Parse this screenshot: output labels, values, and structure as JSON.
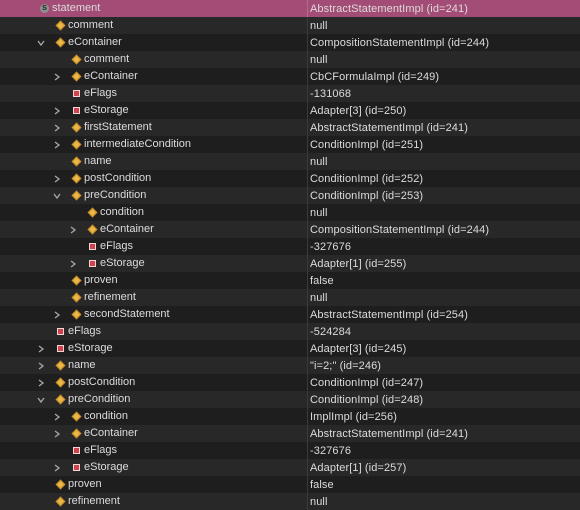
{
  "rows": [
    {
      "name": "statement",
      "value": "AbstractStatementImpl  (id=241)",
      "depth": 0,
      "chev": "none",
      "icon": "static",
      "selected": true
    },
    {
      "name": "comment",
      "value": "null",
      "depth": 1,
      "chev": "none",
      "icon": "diamond"
    },
    {
      "name": "eContainer",
      "value": "CompositionStatementImpl  (id=244)",
      "depth": 1,
      "chev": "down",
      "icon": "diamond"
    },
    {
      "name": "comment",
      "value": "null",
      "depth": 2,
      "chev": "none",
      "icon": "diamond"
    },
    {
      "name": "eContainer",
      "value": "CbCFormulaImpl  (id=249)",
      "depth": 2,
      "chev": "right",
      "icon": "diamond"
    },
    {
      "name": "eFlags",
      "value": "-131068",
      "depth": 2,
      "chev": "none",
      "icon": "square"
    },
    {
      "name": "eStorage",
      "value": "Adapter[3]  (id=250)",
      "depth": 2,
      "chev": "right",
      "icon": "square"
    },
    {
      "name": "firstStatement",
      "value": "AbstractStatementImpl  (id=241)",
      "depth": 2,
      "chev": "right",
      "icon": "diamond"
    },
    {
      "name": "intermediateCondition",
      "value": "ConditionImpl  (id=251)",
      "depth": 2,
      "chev": "right",
      "icon": "diamond"
    },
    {
      "name": "name",
      "value": "null",
      "depth": 2,
      "chev": "none",
      "icon": "diamond"
    },
    {
      "name": "postCondition",
      "value": "ConditionImpl  (id=252)",
      "depth": 2,
      "chev": "right",
      "icon": "diamond"
    },
    {
      "name": "preCondition",
      "value": "ConditionImpl  (id=253)",
      "depth": 2,
      "chev": "down",
      "icon": "diamond"
    },
    {
      "name": "condition",
      "value": "null",
      "depth": 3,
      "chev": "none",
      "icon": "diamond"
    },
    {
      "name": "eContainer",
      "value": "CompositionStatementImpl  (id=244)",
      "depth": 3,
      "chev": "right",
      "icon": "diamond"
    },
    {
      "name": "eFlags",
      "value": "-327676",
      "depth": 3,
      "chev": "none",
      "icon": "square"
    },
    {
      "name": "eStorage",
      "value": "Adapter[1]  (id=255)",
      "depth": 3,
      "chev": "right",
      "icon": "square"
    },
    {
      "name": "proven",
      "value": "false",
      "depth": 2,
      "chev": "none",
      "icon": "diamond"
    },
    {
      "name": "refinement",
      "value": "null",
      "depth": 2,
      "chev": "none",
      "icon": "diamond"
    },
    {
      "name": "secondStatement",
      "value": "AbstractStatementImpl  (id=254)",
      "depth": 2,
      "chev": "right",
      "icon": "diamond"
    },
    {
      "name": "eFlags",
      "value": "-524284",
      "depth": 1,
      "chev": "none",
      "icon": "square"
    },
    {
      "name": "eStorage",
      "value": "Adapter[3]  (id=245)",
      "depth": 1,
      "chev": "right",
      "icon": "square"
    },
    {
      "name": "name",
      "value": "\"i=2;\" (id=246)",
      "depth": 1,
      "chev": "right",
      "icon": "diamond"
    },
    {
      "name": "postCondition",
      "value": "ConditionImpl  (id=247)",
      "depth": 1,
      "chev": "right",
      "icon": "diamond"
    },
    {
      "name": "preCondition",
      "value": "ConditionImpl  (id=248)",
      "depth": 1,
      "chev": "down",
      "icon": "diamond"
    },
    {
      "name": "condition",
      "value": "ImplImpl  (id=256)",
      "depth": 2,
      "chev": "right",
      "icon": "diamond"
    },
    {
      "name": "eContainer",
      "value": "AbstractStatementImpl  (id=241)",
      "depth": 2,
      "chev": "right",
      "icon": "diamond"
    },
    {
      "name": "eFlags",
      "value": "-327676",
      "depth": 2,
      "chev": "none",
      "icon": "square"
    },
    {
      "name": "eStorage",
      "value": "Adapter[1]  (id=257)",
      "depth": 2,
      "chev": "right",
      "icon": "square"
    },
    {
      "name": "proven",
      "value": "false",
      "depth": 1,
      "chev": "none",
      "icon": "diamond"
    },
    {
      "name": "refinement",
      "value": "null",
      "depth": 1,
      "chev": "none",
      "icon": "diamond"
    }
  ],
  "icons": {
    "static": "static-field-icon",
    "diamond": "field-diamond-icon",
    "square": "private-field-icon"
  },
  "static_marker": "S",
  "colors": {
    "selected_row": "#a24c76",
    "field_icon": "#e8b64a",
    "private_icon": "#d0434e",
    "background": "#1e1e1e"
  }
}
